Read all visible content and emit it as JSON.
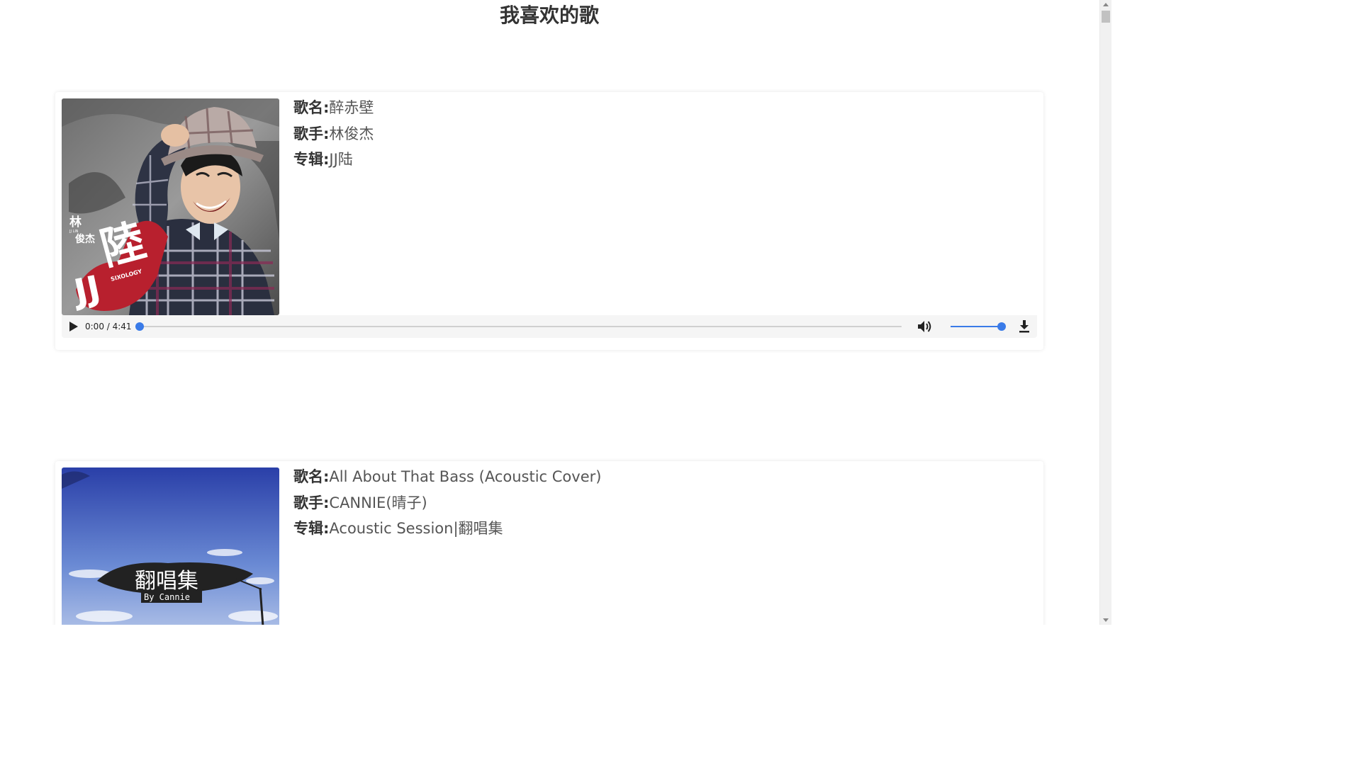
{
  "page": {
    "title": "我喜欢的歌"
  },
  "labels": {
    "song": "歌名:",
    "artist": "歌手:",
    "album": "专辑:"
  },
  "songs": [
    {
      "title": "醉赤壁",
      "artist": "林俊杰",
      "album": "JJ陆",
      "cover_icon": "album-cover-jj-lu",
      "cover_text": [
        "林",
        "俊杰",
        "陸",
        "JJ",
        "SIXOLOGY"
      ],
      "player": {
        "time": "0:00 / 4:41",
        "progress": 0,
        "volume": 1.0
      }
    },
    {
      "title": "All About That Bass (Acoustic Cover)",
      "artist": "CANNIE(晴子)",
      "album": "Acoustic Session|翻唱集",
      "cover_icon": "album-cover-acoustic-session",
      "cover_text": [
        "翻唱集",
        "By Cannie"
      ]
    }
  ],
  "icons": {
    "play": "play-icon",
    "volume": "volume-icon",
    "download": "download-icon"
  },
  "colors": {
    "accent": "#3a7be8",
    "title": "#333333",
    "player_bg": "#f5f5f5"
  }
}
